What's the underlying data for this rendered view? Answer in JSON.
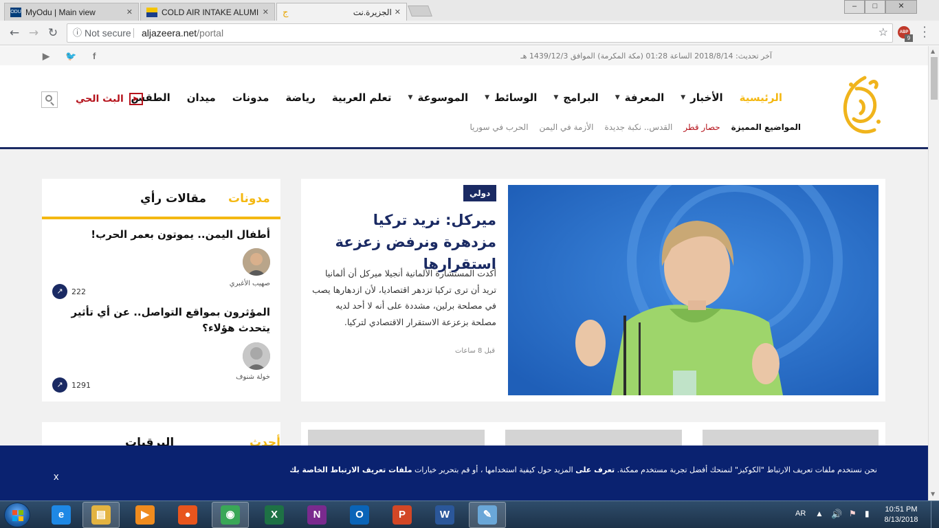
{
  "browser": {
    "tabs": [
      {
        "title": "MyOdu | Main view",
        "icon": "odu-icon"
      },
      {
        "title": "COLD AIR INTAKE ALUMI",
        "icon": "shop-icon"
      },
      {
        "title": "الجزيرة.نت",
        "icon": "aljazeera-icon"
      }
    ],
    "tab_close": "✕",
    "window_controls": {
      "minimize": "–",
      "maximize": "□",
      "close": "✕"
    },
    "security_label": "Not secure",
    "url_host": "aljazeera.net",
    "url_path": "/portal",
    "extension_badge": "ABP",
    "extension_count": "9"
  },
  "site": {
    "last_updated": "آخر تحديث: 2018/8/14 الساعة 01:28 (مكة المكرمة) الموافق 1439/12/3 هـ",
    "social_icons": [
      "facebook-icon",
      "twitter-icon",
      "youtube-icon"
    ],
    "nav": {
      "items": [
        {
          "label": "الرئيسية",
          "dropdown": false,
          "active": true
        },
        {
          "label": "الأخبار",
          "dropdown": true
        },
        {
          "label": "المعرفة",
          "dropdown": true
        },
        {
          "label": "البرامج",
          "dropdown": true
        },
        {
          "label": "الوسائط",
          "dropdown": true
        },
        {
          "label": "الموسوعة",
          "dropdown": true
        },
        {
          "label": "تعلم العربية",
          "dropdown": false
        },
        {
          "label": "رياضة",
          "dropdown": false
        },
        {
          "label": "مدونات",
          "dropdown": false
        },
        {
          "label": "ميدان",
          "dropdown": false
        },
        {
          "label": "الطقس",
          "dropdown": false
        }
      ],
      "live_label": "البث الحي"
    },
    "featured_topics": {
      "label": "المواضيع المميزة",
      "items": [
        "حصار قطر",
        "القدس.. نكبة جديدة",
        "الأزمة في اليمن",
        "الحرب في سوريا"
      ]
    }
  },
  "featured": {
    "badge": "دولي",
    "title": "ميركل: نريد تركيا مزدهرة ونرفض زعزعة استقرارها",
    "description": "أكدت المستشارة الألمانية أنجيلا ميركل أن ألمانيا تريد أن ترى تركيا تزدهر اقتصاديا، لأن ازدهارها يصب في مصلحة برلين، مشددة على أنه لا أحد لديه مصلحة بزعزعة الاستقرار الاقتصادي لتركيا.",
    "time": "قبل 8 ساعات"
  },
  "sidebar": {
    "tabs": [
      {
        "label": "مدونات",
        "active": true
      },
      {
        "label": "مقالات رأي",
        "active": false
      }
    ],
    "items": [
      {
        "title": "أطفال اليمن.. يموتون بعمر الحرب!",
        "author": "صهيب الأغبري",
        "count": "222"
      },
      {
        "title": "المؤثرون بمواقع التواصل.. عن أي تأثير يتحدث هؤلاء؟",
        "author": "خولة شنوف",
        "count": "1291"
      }
    ]
  },
  "second_row": {
    "tabs": [
      {
        "label": "أحدث الأخبار",
        "active": true
      },
      {
        "label": "البرقيات",
        "active": false
      }
    ]
  },
  "cookie_banner": {
    "text_1": "نحن نستخدم ملفات تعريف الارتباط \"الكوكيز\" لنمنحك أفضل تجربة مستخدم ممكنة.",
    "link_1": "تعرف على",
    "text_2": "المزيد حول كيفية استخدامها ، أو قم بتحرير خيارات",
    "link_2": "ملفات تعريف الارتباط الخاصة بك",
    "close": "x"
  },
  "taskbar": {
    "apps": [
      {
        "name": "internet-explorer-icon",
        "glyph": "e",
        "color": "#1e88e5"
      },
      {
        "name": "file-explorer-icon",
        "glyph": "▤",
        "color": "#e3b341"
      },
      {
        "name": "media-player-icon",
        "glyph": "▶",
        "color": "#ef8b1e"
      },
      {
        "name": "firefox-icon",
        "glyph": "●",
        "color": "#e8551d"
      },
      {
        "name": "chrome-icon",
        "glyph": "◉",
        "color": "#3aa757"
      },
      {
        "name": "excel-icon",
        "glyph": "X",
        "color": "#1e7145"
      },
      {
        "name": "onenote-icon",
        "glyph": "N",
        "color": "#7a2a8e"
      },
      {
        "name": "outlook-icon",
        "glyph": "O",
        "color": "#0a64b8"
      },
      {
        "name": "powerpoint-icon",
        "glyph": "P",
        "color": "#d24726"
      },
      {
        "name": "word-icon",
        "glyph": "W",
        "color": "#2b579a"
      },
      {
        "name": "paint-icon",
        "glyph": "✎",
        "color": "#6aa7d8"
      }
    ],
    "lang": "AR",
    "time": "10:51 PM",
    "date": "8/13/2018"
  }
}
